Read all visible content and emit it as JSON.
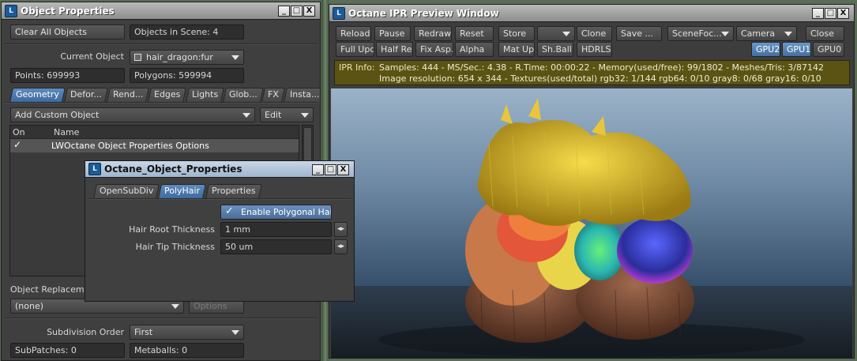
{
  "object_props": {
    "title": "Object Properties",
    "clear_all": "Clear All Objects",
    "objects_in_scene": "Objects in Scene: 4",
    "current_object_label": "Current Object",
    "current_object_value": "hair_dragon:fur",
    "points": "Points: 699993",
    "polygons": "Polygons: 599994",
    "tabs": [
      "Geometry",
      "Defor...",
      "Rend...",
      "Edges",
      "Lights",
      "Glob...",
      "FX",
      "Insta..."
    ],
    "add_custom_object": "Add Custom Object",
    "edit": "Edit",
    "col_on": "On",
    "col_name": "Name",
    "row_check": "✓",
    "row_name": "LWOctane Object Properties Options",
    "object_replacement": "Object Replacement",
    "replacement_value": "(none)",
    "options": "Options",
    "subdivision_order_label": "Subdivision Order",
    "subdivision_order_value": "First",
    "subpatches": "SubPatches: 0",
    "metaballs": "Metaballs: 0"
  },
  "ipr": {
    "title": "Octane IPR Preview Window",
    "row1": [
      "Reload",
      "Pause",
      "Redraw",
      "Reset",
      "Store",
      "",
      "Clone",
      "Save ...",
      "SceneFoc...",
      "Camera",
      "Close"
    ],
    "row2": [
      "Full Upd.",
      "Half Res",
      "Fix Asp.",
      "Alpha",
      "Mat Upd",
      "Sh.Ball",
      "HDRLS"
    ],
    "gpus": [
      "GPU2",
      "GPU1",
      "GPU0"
    ],
    "info_label": "IPR Info:",
    "info_line1": "Samples: 444  -  MS/Sec.: 4.38  -  R.Time: 00:00:22 - Memory(used/free): 99/1802  -  Meshes/Tris: 3/87142",
    "info_line2": "Image resolution: 654 x 344 - Textures(used/total) rgb32: 1/144   rgb64: 0/10   gray8: 0/68   gray16: 0/10"
  },
  "octane_dialog": {
    "title": "Octane_Object_Properties",
    "tabs": [
      "OpenSubDiv",
      "PolyHair",
      "Properties"
    ],
    "enable_poly_hair": "Enable Polygonal Hair",
    "root_label": "Hair Root Thickness",
    "root_value": "1 mm",
    "tip_label": "Hair Tip Thickness",
    "tip_value": "50 um"
  },
  "window_buttons": {
    "minimize": "_",
    "maximize": "□",
    "close": "X"
  },
  "colors": {
    "accent": "#4a78ab",
    "ipr_info_bg": "#5a5313"
  }
}
